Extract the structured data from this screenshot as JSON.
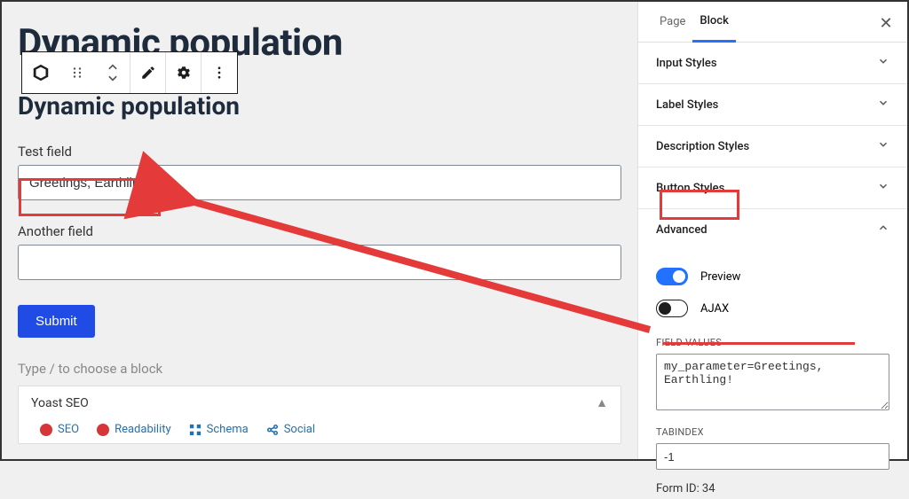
{
  "main": {
    "page_title": "Dynamic population",
    "section_title": "Dynamic population",
    "fields": [
      {
        "label": "Test field",
        "value": "Greetings, Earthling!"
      },
      {
        "label": "Another field",
        "value": ""
      }
    ],
    "submit_label": "Submit",
    "slash_hint": "Type / to choose a block"
  },
  "yoast": {
    "title": "Yoast SEO",
    "tabs": [
      "SEO",
      "Readability",
      "Schema",
      "Social"
    ]
  },
  "sidebar": {
    "tabs": {
      "page": "Page",
      "block": "Block"
    },
    "sections": {
      "input_styles": "Input Styles",
      "label_styles": "Label Styles",
      "description_styles": "Description Styles",
      "button_styles": "Button Styles",
      "advanced": "Advanced"
    },
    "advanced": {
      "preview_label": "Preview",
      "ajax_label": "AJAX",
      "field_values_label": "FIELD VALUES",
      "field_values": "my_parameter=Greetings, Earthling!",
      "tabindex_label": "TABINDEX",
      "tabindex": "-1",
      "form_id_label": "Form ID: 34"
    }
  }
}
